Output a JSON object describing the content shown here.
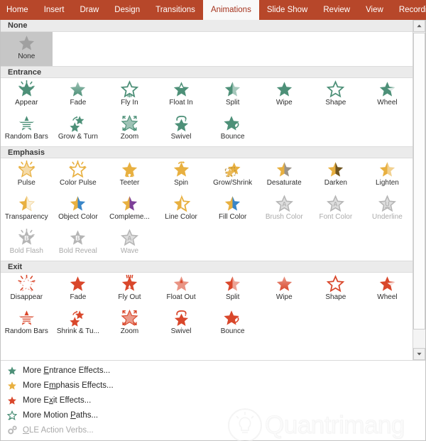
{
  "ribbon": {
    "tabs": [
      {
        "label": "Home",
        "active": false
      },
      {
        "label": "Insert",
        "active": false
      },
      {
        "label": "Draw",
        "active": false
      },
      {
        "label": "Design",
        "active": false
      },
      {
        "label": "Transitions",
        "active": false
      },
      {
        "label": "Animations",
        "active": true
      },
      {
        "label": "Slide Show",
        "active": false
      },
      {
        "label": "Review",
        "active": false
      },
      {
        "label": "View",
        "active": false
      },
      {
        "label": "Recording",
        "active": false
      }
    ],
    "active_tab": "Animations",
    "tab_bar_color": "#b7472a",
    "active_tab_color": "#f9f9f9",
    "active_tab_text_color": "#a5331d"
  },
  "gallery": {
    "colors": {
      "entrance": "#4d9078",
      "emphasis": "#e8b040",
      "exit": "#d9472b",
      "disabled": "#b5b5b5",
      "none": "#a0a0a0",
      "selected_background": "#c6c6c6",
      "section_header_background": "#ebebeb"
    },
    "sections": [
      {
        "name": "None",
        "header": "None",
        "color_key": "none",
        "rows": [
          [
            {
              "label": "None",
              "icon": "star-plain",
              "selected": true,
              "disabled": false
            },
            {
              "label": "",
              "icon": "",
              "empty": true
            },
            {
              "label": "",
              "icon": "",
              "empty": true
            },
            {
              "label": "",
              "icon": "",
              "empty": true
            },
            {
              "label": "",
              "icon": "",
              "empty": true
            },
            {
              "label": "",
              "icon": "",
              "empty": true
            },
            {
              "label": "",
              "icon": "",
              "empty": true
            },
            {
              "label": "",
              "icon": "",
              "empty": true
            }
          ]
        ]
      },
      {
        "name": "Entrance",
        "header": "Entrance",
        "color_key": "entrance",
        "rows": [
          [
            {
              "label": "Appear",
              "icon": "star-sparkle",
              "disabled": false
            },
            {
              "label": "Fade",
              "icon": "star-gradient",
              "disabled": false
            },
            {
              "label": "Fly In",
              "icon": "star-fly-up",
              "disabled": false
            },
            {
              "label": "Float In",
              "icon": "star-float-up",
              "disabled": false
            },
            {
              "label": "Split",
              "icon": "star-split",
              "disabled": false
            },
            {
              "label": "Wipe",
              "icon": "star-plain",
              "disabled": false
            },
            {
              "label": "Shape",
              "icon": "star-outline",
              "disabled": false
            },
            {
              "label": "Wheel",
              "icon": "star-wheel",
              "disabled": false
            }
          ],
          [
            {
              "label": "Random Bars",
              "icon": "star-bars",
              "disabled": false
            },
            {
              "label": "Grow & Turn",
              "icon": "star-grow-turn",
              "disabled": false
            },
            {
              "label": "Zoom",
              "icon": "star-zoom-in",
              "disabled": false
            },
            {
              "label": "Swivel",
              "icon": "star-swivel",
              "disabled": false
            },
            {
              "label": "Bounce",
              "icon": "star-bounce",
              "disabled": false
            },
            {
              "label": "",
              "icon": "",
              "empty": true
            },
            {
              "label": "",
              "icon": "",
              "empty": true
            },
            {
              "label": "",
              "icon": "",
              "empty": true
            }
          ]
        ]
      },
      {
        "name": "Emphasis",
        "header": "Emphasis",
        "color_key": "emphasis",
        "rows": [
          [
            {
              "label": "Pulse",
              "icon": "star-pulse",
              "disabled": false
            },
            {
              "label": "Color Pulse",
              "icon": "star-color-pulse",
              "disabled": false
            },
            {
              "label": "Teeter",
              "icon": "star-teeter",
              "disabled": false
            },
            {
              "label": "Spin",
              "icon": "star-spin",
              "disabled": false
            },
            {
              "label": "Grow/Shrink",
              "icon": "star-grow-shrink",
              "disabled": false
            },
            {
              "label": "Desaturate",
              "icon": "star-half-gray",
              "disabled": false
            },
            {
              "label": "Darken",
              "icon": "star-half-dark",
              "disabled": false
            },
            {
              "label": "Lighten",
              "icon": "star-half-light",
              "disabled": false
            }
          ],
          [
            {
              "label": "Transparency",
              "icon": "star-half-pale",
              "disabled": false
            },
            {
              "label": "Object Color",
              "icon": "star-half-blue",
              "disabled": false
            },
            {
              "label": "Compleme...",
              "icon": "star-half-purple",
              "disabled": false
            },
            {
              "label": "Line Color",
              "icon": "star-outline-half",
              "disabled": false
            },
            {
              "label": "Fill Color",
              "icon": "star-half-blue",
              "disabled": false
            },
            {
              "label": "Brush Color",
              "icon": "star-letter-a",
              "disabled": true
            },
            {
              "label": "Font Color",
              "icon": "star-letter-a",
              "disabled": true
            },
            {
              "label": "Underline",
              "icon": "star-letter-u",
              "disabled": true
            }
          ],
          [
            {
              "label": "Bold Flash",
              "icon": "star-letter-b-sparkle",
              "disabled": true
            },
            {
              "label": "Bold Reveal",
              "icon": "star-letter-b",
              "disabled": true
            },
            {
              "label": "Wave",
              "icon": "star-letter-a",
              "disabled": true
            },
            {
              "label": "",
              "icon": "",
              "empty": true
            },
            {
              "label": "",
              "icon": "",
              "empty": true
            },
            {
              "label": "",
              "icon": "",
              "empty": true
            },
            {
              "label": "",
              "icon": "",
              "empty": true
            },
            {
              "label": "",
              "icon": "",
              "empty": true
            }
          ]
        ]
      },
      {
        "name": "Exit",
        "header": "Exit",
        "color_key": "exit",
        "rows": [
          [
            {
              "label": "Disappear",
              "icon": "star-disappear",
              "disabled": false
            },
            {
              "label": "Fade",
              "icon": "star-plain",
              "disabled": false
            },
            {
              "label": "Fly Out",
              "icon": "star-fly-out",
              "disabled": false
            },
            {
              "label": "Float Out",
              "icon": "star-float-out",
              "disabled": false
            },
            {
              "label": "Split",
              "icon": "star-split",
              "disabled": false
            },
            {
              "label": "Wipe",
              "icon": "star-gradient",
              "disabled": false
            },
            {
              "label": "Shape",
              "icon": "star-outline",
              "disabled": false
            },
            {
              "label": "Wheel",
              "icon": "star-wheel",
              "disabled": false
            }
          ],
          [
            {
              "label": "Random Bars",
              "icon": "star-bars",
              "disabled": false
            },
            {
              "label": "Shrink & Tu...",
              "icon": "star-grow-turn",
              "disabled": false
            },
            {
              "label": "Zoom",
              "icon": "star-zoom-out",
              "disabled": false
            },
            {
              "label": "Swivel",
              "icon": "star-swivel",
              "disabled": false
            },
            {
              "label": "Bounce",
              "icon": "star-bounce",
              "disabled": false
            },
            {
              "label": "",
              "icon": "",
              "empty": true
            },
            {
              "label": "",
              "icon": "",
              "empty": true
            },
            {
              "label": "",
              "icon": "",
              "empty": true
            }
          ]
        ]
      }
    ]
  },
  "menu": {
    "items": [
      {
        "label": "More Entrance Effects...",
        "accel_index": 5,
        "icon": "star-green-icon",
        "color": "#4d9078",
        "disabled": false
      },
      {
        "label": "More Emphasis Effects...",
        "accel_index": 6,
        "icon": "star-yellow-icon",
        "color": "#e8b040",
        "disabled": false
      },
      {
        "label": "More Exit Effects...",
        "accel_index": 6,
        "icon": "star-red-icon",
        "color": "#d9472b",
        "disabled": false
      },
      {
        "label": "More Motion Paths...",
        "accel_index": 12,
        "icon": "star-path-icon",
        "color": "#4d9078",
        "disabled": false
      },
      {
        "label": "OLE Action Verbs...",
        "accel_index": 0,
        "icon": "gears-icon",
        "color": "#b0b0b0",
        "disabled": true
      }
    ]
  },
  "scrollbar": {
    "up_arrow": "chevron-up-icon",
    "down_arrow": "chevron-down-icon",
    "thumb_position_percent": 0
  },
  "watermark": {
    "text": "Quantrimang",
    "mark": "lightbulb-circle-icon"
  }
}
